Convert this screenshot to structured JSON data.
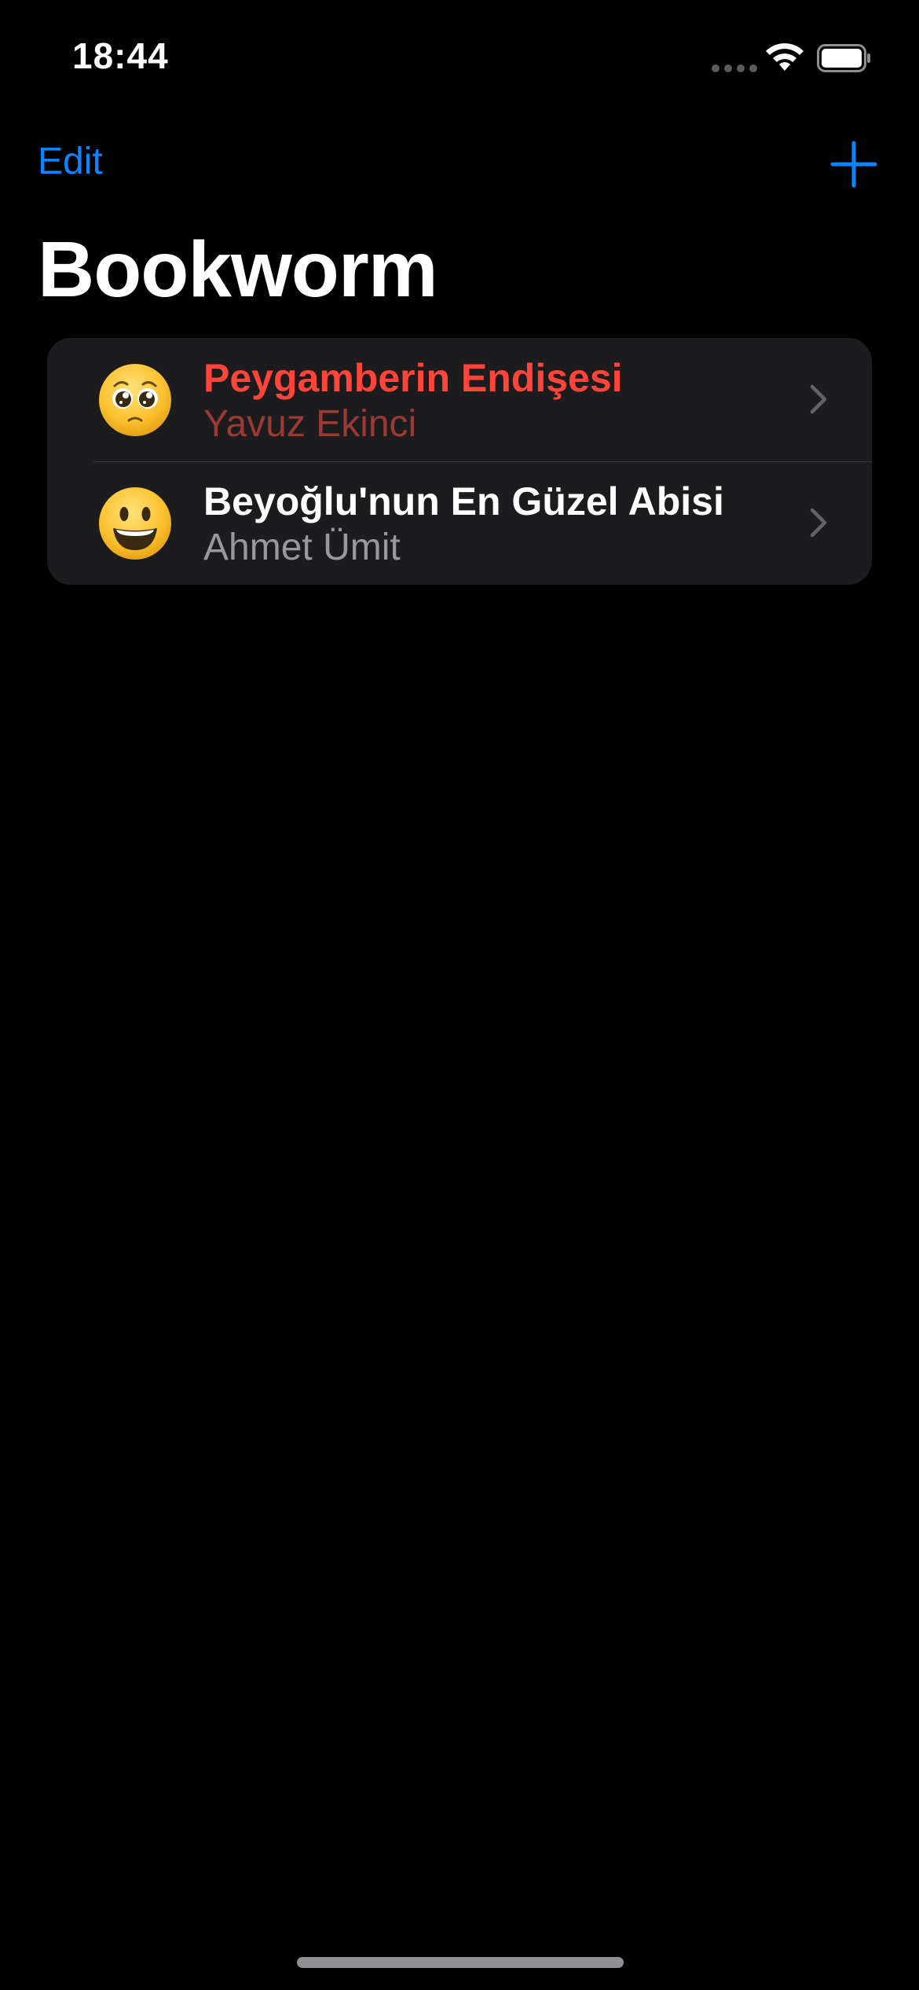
{
  "status_bar": {
    "time": "18:44"
  },
  "nav": {
    "edit_label": "Edit",
    "add_icon": "plus-icon",
    "title": "Bookworm"
  },
  "colors": {
    "accent": "#0a84ff",
    "highlight_title": "#ff453a",
    "highlight_author": "#9b3a34",
    "author": "#98989d",
    "row_bg": "#1c1c1e"
  },
  "books": [
    {
      "title": "Peygamberin Endişesi",
      "author": "Yavuz Ekinci",
      "emoji_icon": "pleading-face-icon",
      "highlighted": true
    },
    {
      "title": "Beyoğlu'nun En Güzel Abisi",
      "author": "Ahmet Ümit",
      "emoji_icon": "smiling-face-icon",
      "highlighted": false
    }
  ]
}
